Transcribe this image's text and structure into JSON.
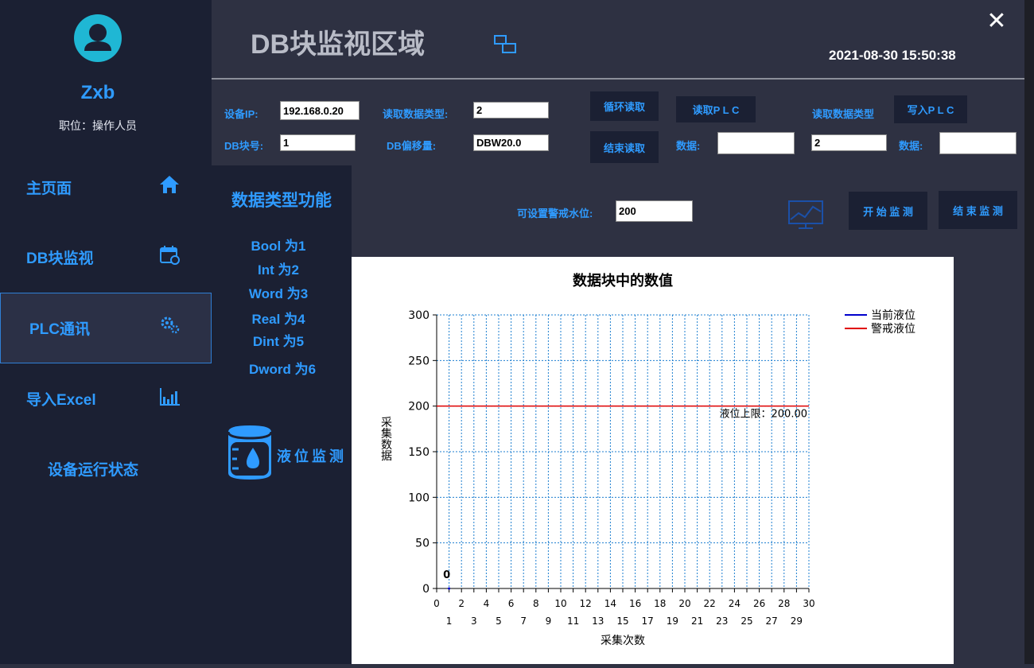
{
  "user": {
    "name": "Zxb",
    "role": "职位：操作人员"
  },
  "nav": [
    {
      "label": "主页面",
      "icon": "home-icon"
    },
    {
      "label": "DB块监视",
      "icon": "calendar-icon"
    },
    {
      "label": "PLC通讯",
      "icon": "gears-icon"
    },
    {
      "label": "导入Excel",
      "icon": "bar-chart-icon"
    },
    {
      "label": "设备运行状态",
      "icon": ""
    }
  ],
  "header": {
    "title": "DB块监视区域",
    "datetime": "2021-08-30 15:50:38"
  },
  "controls": {
    "ip_label": "设备IP:",
    "ip_value": "192.168.0.20",
    "db_label": "DB块号:",
    "db_value": "1",
    "read_type_label": "读取数据类型:",
    "read_type_value": "2",
    "offset_label": "DB偏移量:",
    "offset_value": "DBW20.0",
    "loop_read": "循环读取",
    "end_read": "结束读取",
    "read_plc": "读取P L C",
    "data_label1": "数据:",
    "data_value1": "",
    "read_type_label2": "读取数据类型",
    "read_type_value2": "2",
    "write_plc": "写入P L C",
    "data_label2": "数据:",
    "data_value2": "",
    "alarm_label": "可设置警戒水位:",
    "alarm_value": "200",
    "start_monitor": "开 始 监 测",
    "end_monitor": "结 束 监 测"
  },
  "datatypes": {
    "title": "数据类型功能",
    "items": [
      "Bool 为1",
      "Int 为2",
      "Word 为3",
      "Real 为4",
      "Dint 为5",
      "Dword 为6"
    ],
    "level_monitor": "液位监测"
  },
  "chart_data": {
    "type": "line",
    "title": "数据块中的数值",
    "xlabel": "采集次数",
    "ylabel": "采集数据",
    "xlim": [
      0,
      30
    ],
    "ylim": [
      0,
      300
    ],
    "xticks_top": [
      "0",
      "2",
      "4",
      "6",
      "8",
      "10",
      "12",
      "14",
      "16",
      "18",
      "20",
      "22",
      "24",
      "26",
      "28",
      "30"
    ],
    "xticks_bottom": [
      "1",
      "3",
      "5",
      "7",
      "9",
      "11",
      "13",
      "15",
      "17",
      "19",
      "21",
      "23",
      "25",
      "27",
      "29"
    ],
    "yticks": [
      "0",
      "50",
      "100",
      "150",
      "200",
      "250",
      "300"
    ],
    "grid": true,
    "legend_position": "top-right",
    "series": [
      {
        "name": "当前液位",
        "color": "#0000cc",
        "x": [
          1
        ],
        "y": [
          0
        ]
      },
      {
        "name": "警戒液位",
        "color": "#e00000",
        "x": [
          0,
          30
        ],
        "y": [
          200,
          200
        ]
      }
    ],
    "point_label": "0",
    "annotation": "液位上限：200.00"
  }
}
